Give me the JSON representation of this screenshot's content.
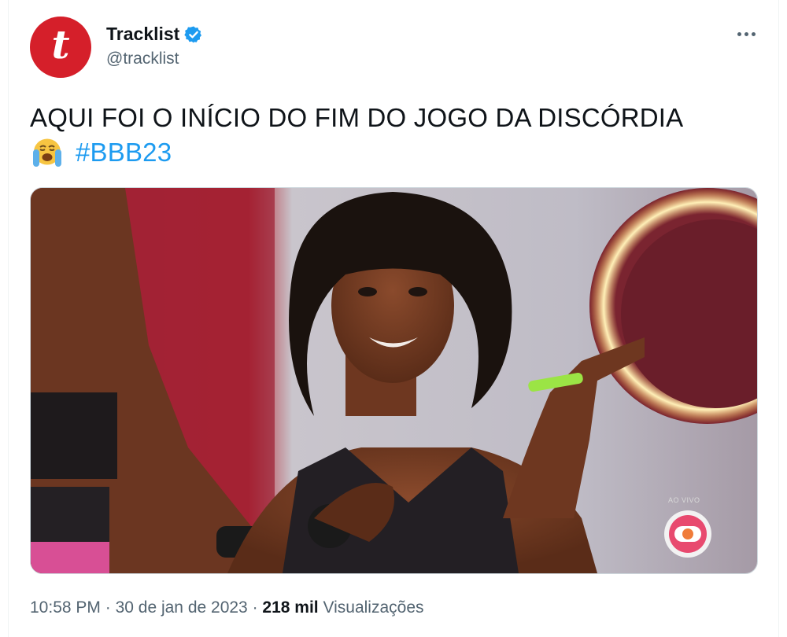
{
  "account": {
    "avatar_letter": "t",
    "display_name": "Tracklist",
    "handle": "@tracklist",
    "verified": true
  },
  "tweet": {
    "text_line1": "AQUI FOI O INÍCIO DO FIM DO JOGO DA DISCÓRDIA",
    "emoji": "loudly-crying-face",
    "hashtag": "#BBB23"
  },
  "media": {
    "overlay_label": "AO VIVO",
    "broadcaster_logo": "globo-logo"
  },
  "meta": {
    "time": "10:58 PM",
    "separator": "·",
    "date": "30 de jan de 2023",
    "views_count": "218 mil",
    "views_label": "Visualizações"
  },
  "colors": {
    "brand_avatar": "#d51f2a",
    "link": "#1d9bf0",
    "verified": "#1d9bf0",
    "secondary_text": "#536471"
  },
  "icons": [
    "verified-badge-icon",
    "more-options-icon",
    "loudly-crying-emoji"
  ]
}
